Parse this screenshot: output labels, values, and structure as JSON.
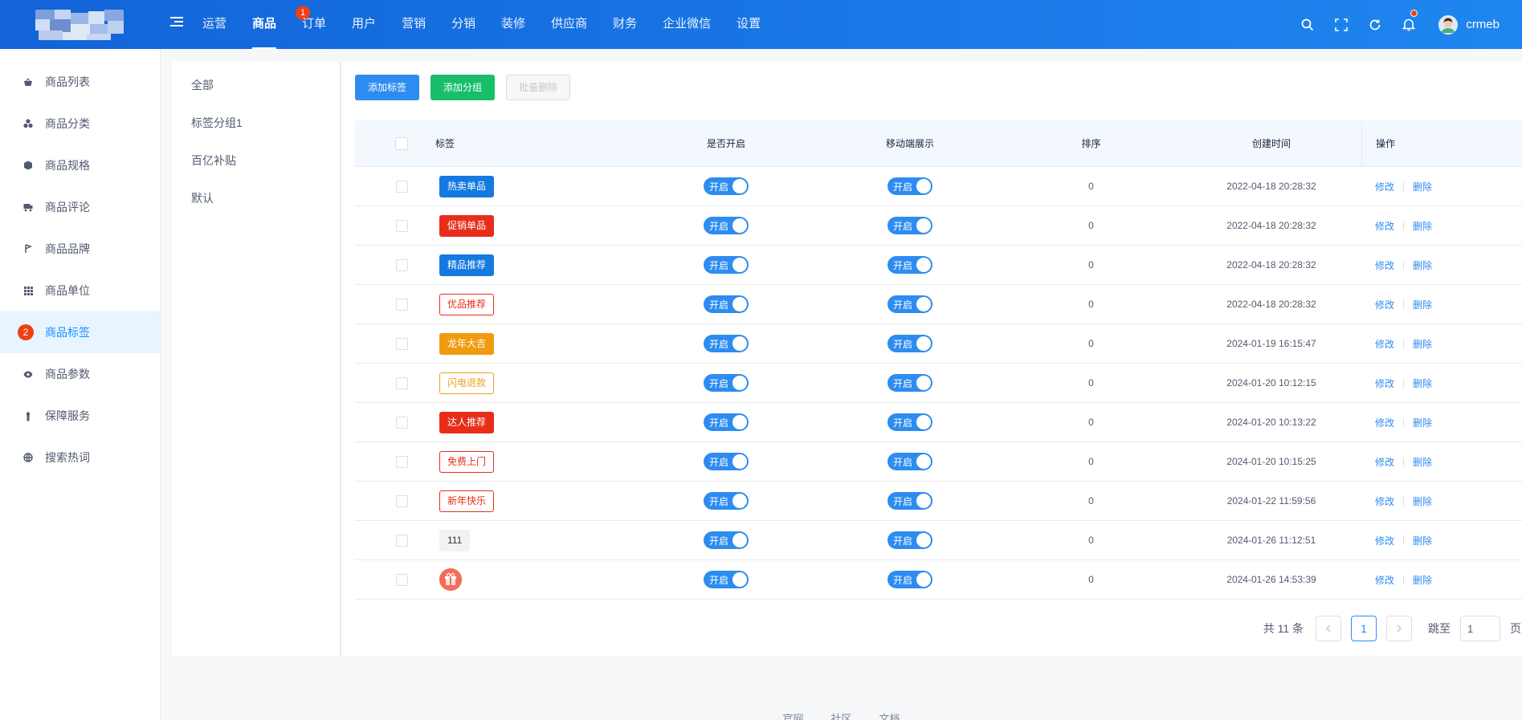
{
  "header": {
    "nav": [
      {
        "label": "运营"
      },
      {
        "label": "商品",
        "active": true,
        "badge": "1"
      },
      {
        "label": "订单"
      },
      {
        "label": "用户"
      },
      {
        "label": "营销"
      },
      {
        "label": "分销"
      },
      {
        "label": "装修"
      },
      {
        "label": "供应商"
      },
      {
        "label": "财务"
      },
      {
        "label": "企业微信"
      },
      {
        "label": "设置"
      }
    ],
    "user_name": "crmeb",
    "icons": [
      "search-icon",
      "fullscreen-icon",
      "refresh-icon",
      "bell-icon"
    ]
  },
  "sidebar": {
    "items": [
      {
        "label": "商品列表",
        "icon": "basket-icon"
      },
      {
        "label": "商品分类",
        "icon": "category-icon"
      },
      {
        "label": "商品规格",
        "icon": "cube-icon"
      },
      {
        "label": "商品评论",
        "icon": "comment-icon"
      },
      {
        "label": "商品品牌",
        "icon": "brand-icon"
      },
      {
        "label": "商品单位",
        "icon": "grid-icon"
      },
      {
        "label": "商品标签",
        "icon": "tag-icon",
        "active": true,
        "badge": "2"
      },
      {
        "label": "商品参数",
        "icon": "eye-icon"
      },
      {
        "label": "保障服务",
        "icon": "shield-icon"
      },
      {
        "label": "搜索热词",
        "icon": "globe-icon"
      }
    ]
  },
  "groups": [
    "全部",
    "标签分组1",
    "百亿补贴",
    "默认"
  ],
  "toolbar": {
    "add_tag": "添加标签",
    "add_group": "添加分组",
    "batch_delete": "批量删除"
  },
  "table": {
    "headers": {
      "tag": "标签",
      "open": "是否开启",
      "mobile": "移动端展示",
      "sort": "排序",
      "time": "创建时间",
      "op": "操作"
    },
    "rows": [
      {
        "tag": "热卖单品",
        "style": "fill-blue",
        "open": "开启",
        "mobile": "开启",
        "sort": "0",
        "time": "2022-04-18 20:28:32"
      },
      {
        "tag": "促销单品",
        "style": "fill-red",
        "open": "开启",
        "mobile": "开启",
        "sort": "0",
        "time": "2022-04-18 20:28:32"
      },
      {
        "tag": "精品推荐",
        "style": "fill-blue",
        "open": "开启",
        "mobile": "开启",
        "sort": "0",
        "time": "2022-04-18 20:28:32"
      },
      {
        "tag": "优品推荐",
        "style": "line-red",
        "open": "开启",
        "mobile": "开启",
        "sort": "0",
        "time": "2022-04-18 20:28:32"
      },
      {
        "tag": "龙年大吉",
        "style": "fill-orange",
        "open": "开启",
        "mobile": "开启",
        "sort": "0",
        "time": "2024-01-19 16:15:47"
      },
      {
        "tag": "闪电退款",
        "style": "line-orange",
        "open": "开启",
        "mobile": "开启",
        "sort": "0",
        "time": "2024-01-20 10:12:15"
      },
      {
        "tag": "达人推荐",
        "style": "fill-red",
        "open": "开启",
        "mobile": "开启",
        "sort": "0",
        "time": "2024-01-20 10:13:22"
      },
      {
        "tag": "免费上门",
        "style": "line-red",
        "open": "开启",
        "mobile": "开启",
        "sort": "0",
        "time": "2024-01-20 10:15:25"
      },
      {
        "tag": "新年快乐",
        "style": "line-red",
        "open": "开启",
        "mobile": "开启",
        "sort": "0",
        "time": "2024-01-22 11:59:56"
      },
      {
        "tag": "111",
        "style": "gray",
        "open": "开启",
        "mobile": "开启",
        "sort": "0",
        "time": "2024-01-26 11:12:51"
      },
      {
        "tag": "",
        "style": "icon",
        "open": "开启",
        "mobile": "开启",
        "sort": "0",
        "time": "2024-01-26 14:53:39"
      }
    ],
    "edit_label": "修改",
    "delete_label": "删除"
  },
  "pagination": {
    "total": "共 11 条",
    "current": "1",
    "jump_label": "跳至",
    "jump_value": "1",
    "page_suffix": "页"
  },
  "footer": {
    "links": [
      "官网",
      "社区",
      "文档"
    ]
  },
  "colors": {
    "header_start": "#1264d8",
    "header_end": "#1f86f0",
    "primary": "#2d8cf0",
    "success": "#19be6b",
    "danger": "#e82e1a",
    "warning": "#f09a0f"
  }
}
